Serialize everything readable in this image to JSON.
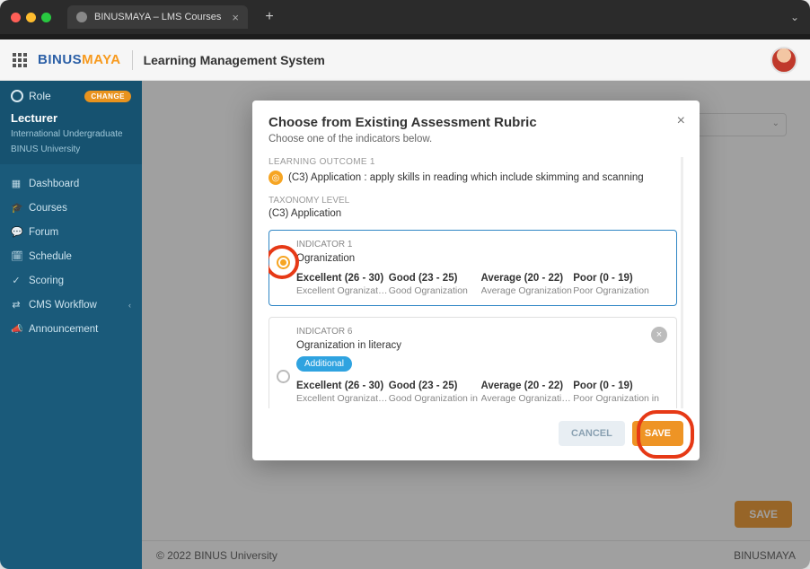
{
  "browser": {
    "tab_title": "BINUSMAYA – LMS Courses"
  },
  "header": {
    "logo_part1": "BINUS",
    "logo_part2": "MAYA",
    "system_title": "Learning Management System"
  },
  "sidebar": {
    "role_label": "Role",
    "change_label": "CHANGE",
    "role_name": "Lecturer",
    "role_sub1": "International Undergraduate",
    "role_sub2": "BINUS University",
    "items": [
      {
        "icon": "▦",
        "label": "Dashboard"
      },
      {
        "icon": "🎓",
        "label": "Courses"
      },
      {
        "icon": "💬",
        "label": "Forum"
      },
      {
        "icon": "🗓",
        "label": "Schedule"
      },
      {
        "icon": "✓",
        "label": "Scoring"
      },
      {
        "icon": "⇄",
        "label": "CMS Workflow",
        "expandable": true
      },
      {
        "icon": "📣",
        "label": "Announcement"
      }
    ]
  },
  "modal": {
    "title": "Choose from Existing Assessment Rubric",
    "subtitle": "Choose one of the indicators below.",
    "lo_label": "LEARNING OUTCOME 1",
    "lo_text": "(C3) Application : apply skills in reading which include skimming and scanning",
    "tax_label": "TAXONOMY LEVEL",
    "tax_value": "(C3) Application",
    "indicators": [
      {
        "label": "INDICATOR 1",
        "title": "Ogranization",
        "selected": true,
        "levels": [
          {
            "title": "Excellent (26 - 30)",
            "desc": "Excellent Ogranization"
          },
          {
            "title": "Good (23 - 25)",
            "desc": "Good Ogranization"
          },
          {
            "title": "Average (20 - 22)",
            "desc": "Average Ogranization"
          },
          {
            "title": "Poor (0 - 19)",
            "desc": "Poor Ogranization"
          }
        ]
      },
      {
        "label": "INDICATOR 6",
        "title": "Ogranization in literacy",
        "additional_badge": "Additional",
        "selected": false,
        "removable": true,
        "levels": [
          {
            "title": "Excellent (26 - 30)",
            "desc": "Excellent Ogranization"
          },
          {
            "title": "Good (23 - 25)",
            "desc": "Good Ogranization in"
          },
          {
            "title": "Average (20 - 22)",
            "desc": "Average Ogranization in"
          },
          {
            "title": "Poor (0 - 19)",
            "desc": "Poor Ogranization in"
          }
        ]
      }
    ],
    "cancel_label": "CANCEL",
    "save_label": "SAVE"
  },
  "page": {
    "save_label": "SAVE"
  },
  "footer": {
    "copyright": "© 2022 BINUS University",
    "brand": "BINUSMAYA"
  }
}
